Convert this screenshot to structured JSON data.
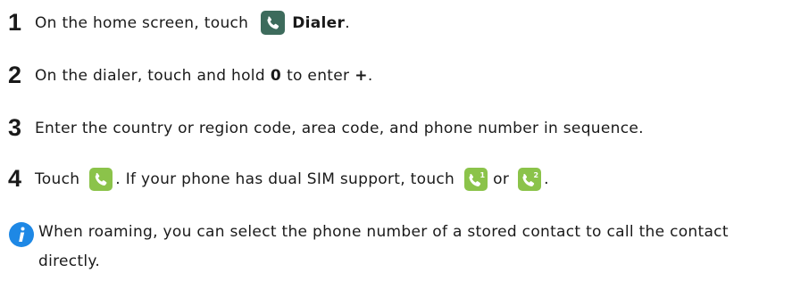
{
  "steps": [
    {
      "number": "1",
      "text_before": "On the home screen, touch",
      "bold_text": "Dialer",
      "text_after": "."
    },
    {
      "number": "2",
      "text_before": "On the dialer, touch and hold",
      "bold_zero": "0",
      "text_middle": "to enter",
      "bold_plus": "+",
      "text_after": "."
    },
    {
      "number": "3",
      "text": "Enter the country or region code, area code, and phone number in sequence."
    },
    {
      "number": "4",
      "text_before": "Touch",
      "text_middle": ". If your phone has dual SIM support, touch",
      "text_or": "or",
      "text_after": ".",
      "sim1_label": "1",
      "sim2_label": "2"
    }
  ],
  "note": {
    "icon": "info-icon",
    "text": "When roaming, you can select the phone number of a stored contact to call the contact directly."
  },
  "colors": {
    "dialer_icon_bg": "#3d6b5c",
    "call_icon_bg": "#8bc34a",
    "info_icon_bg": "#1e88e5",
    "text": "#1a1a1a"
  }
}
